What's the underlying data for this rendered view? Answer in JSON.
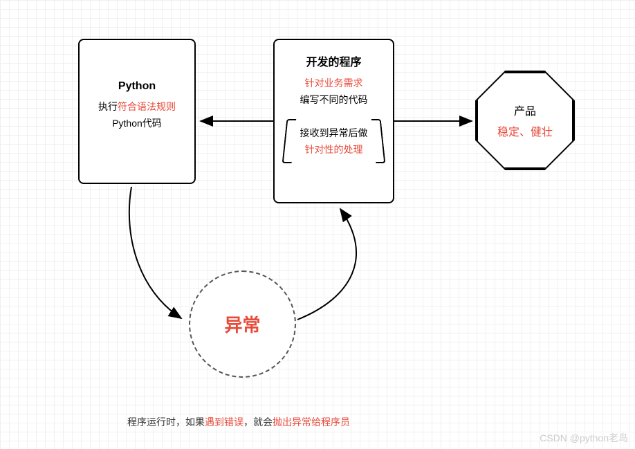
{
  "python_box": {
    "title": "Python",
    "line1_a": "执行",
    "line1_b": "符合语法规则",
    "line2": "Python代码"
  },
  "dev_box": {
    "title": "开发的程序",
    "line1": "针对业务需求",
    "line2": "编写不同的代码",
    "bracket_line1": "接收到异常后做",
    "bracket_line2": "针对性的处理"
  },
  "product_box": {
    "title": "产品",
    "line1": "稳定、健壮"
  },
  "exception_circle": {
    "label": "异常"
  },
  "caption": {
    "p1": "程序运行时，如果",
    "p2": "遇到错误",
    "p3": "，就会",
    "p4": "抛出异常给程序员"
  },
  "watermark": "CSDN @python老鸟"
}
